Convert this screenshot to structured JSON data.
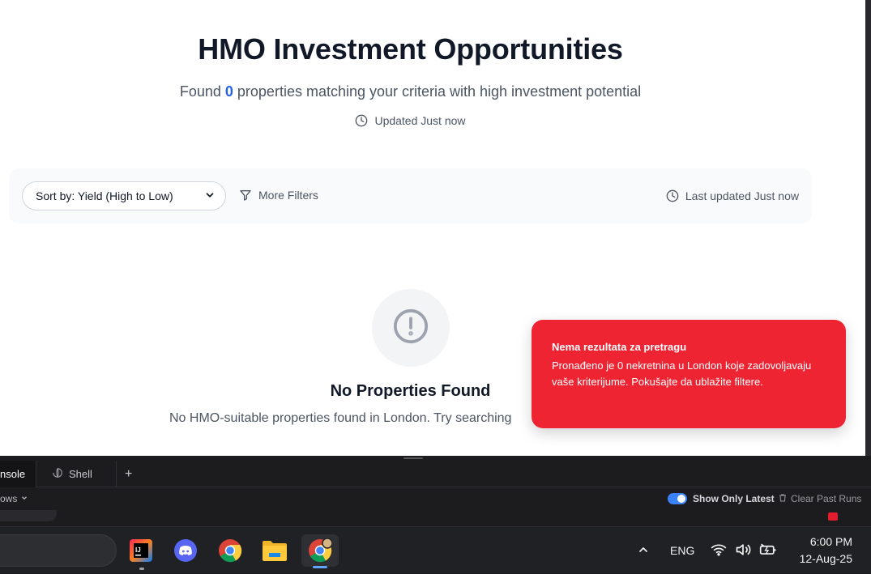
{
  "header": {
    "title": "HMO Investment Opportunities",
    "subtitle_prefix": "Found ",
    "count": "0",
    "subtitle_suffix": " properties matching your criteria with high investment potential",
    "updated": "Updated Just now"
  },
  "toolbar": {
    "sort_label": "Sort by: Yield (High to Low)",
    "more_filters": "More Filters",
    "last_updated": "Last updated Just now"
  },
  "empty_state": {
    "title": "No Properties Found",
    "description": "No HMO-suitable properties found in London. Try searching"
  },
  "toast": {
    "title": "Nema rezultata za pretragu",
    "message": "Pronađeno je 0 nekretnina u London koje zadovoljavaju vaše kriterijume. Pokušajte da ublažite filtere.",
    "color": "#ef2433"
  },
  "devtools": {
    "tabs": [
      "nsole",
      "Shell"
    ],
    "add_tab": "+",
    "filter_label": "ows",
    "show_only_latest": "Show Only Latest",
    "clear_past_runs": "Clear Past Runs"
  },
  "taskbar": {
    "language": "ENG",
    "time": "6:00 PM",
    "date": "12-Aug-25"
  },
  "colors": {
    "accent": "#2563eb",
    "text_primary": "#111827",
    "text_secondary": "#4b5563"
  }
}
